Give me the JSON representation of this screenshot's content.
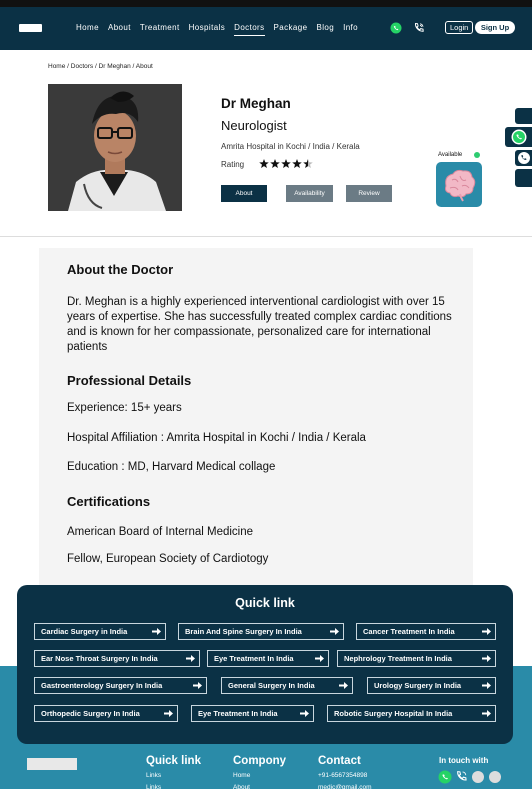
{
  "nav": {
    "links": [
      "Home",
      "About",
      "Treatment",
      "Hospitals",
      "Doctors",
      "Package",
      "Blog",
      "Info"
    ],
    "active_index": 4,
    "login": "Login",
    "signup": "Sign Up"
  },
  "breadcrumb": "Home / Doctors / Dr Meghan / About",
  "profile": {
    "name": "Dr Meghan",
    "specialty": "Neurologist",
    "hospital": "Amrita Hospital in Kochi / India / Kerala",
    "rating_label": "Rating",
    "rating_value": 4.5,
    "rating_max": 5,
    "buttons": [
      "About",
      "Availability",
      "Review"
    ],
    "available_label": "Available"
  },
  "about": {
    "heading": "About the Doctor",
    "bio": "Dr. Meghan is a highly experienced interventional cardiologist with over 15 years of expertise. She has successfully treated complex cardiac conditions and is known for her compassionate, personalized care for international patients",
    "professional_heading": "Professional Details",
    "experience": "Experience: 15+ years",
    "affiliation": "Hospital Affiliation : Amrita Hospital in Kochi / India / Kerala",
    "education": "Education : MD, Harvard Medical collage",
    "cert_heading": "Certifications",
    "certs": [
      "American Board of Internal Medicine",
      "Fellow, European Society of Cardiotogy"
    ]
  },
  "quick_links": {
    "title": "Quick link",
    "rows": [
      [
        "Cardiac Surgery in India",
        "Brain And Spine Surgery In India",
        "Cancer Treatment In India"
      ],
      [
        "Ear Nose Throat Surgery In India",
        "Eye Treatment In India",
        "Nephrology Treatment In India"
      ],
      [
        "Gastroenterology Surgery In India",
        "General Surgery In India",
        "Urology Surgery In India"
      ],
      [
        "Orthopedic Surgery In India",
        "Eye Treatment In India",
        "Robotic Surgery Hospital In India"
      ]
    ]
  },
  "footer": {
    "quick_heading": "Quick link",
    "quick_items": [
      "Links",
      "Links"
    ],
    "company_heading": "Compony",
    "company_items": [
      "Home",
      "About"
    ],
    "contact_heading": "Contact",
    "phone": "+91-6567354898",
    "email": "medic@gmail.com",
    "touch": "In touch with"
  },
  "colors": {
    "navy": "#0b3145",
    "teal": "#2a8ba8",
    "grey_button": "#6b7b85",
    "available": "#2ecc71"
  }
}
